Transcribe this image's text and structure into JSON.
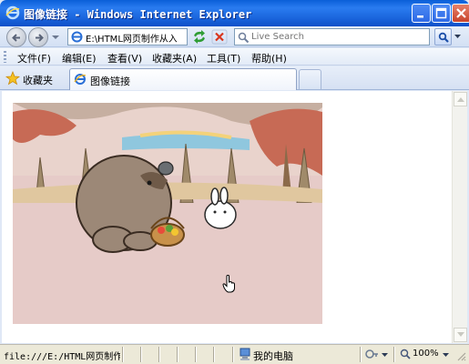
{
  "window": {
    "title": "图像链接 - Windows Internet Explorer"
  },
  "address_bar": {
    "url": "E:\\HTML网页制作从入",
    "search_placeholder": "Live Search"
  },
  "menu": {
    "items": [
      "文件(F)",
      "编辑(E)",
      "查看(V)",
      "收藏夹(A)",
      "工具(T)",
      "帮助(H)"
    ]
  },
  "favorites": {
    "label": "收藏夹"
  },
  "tabs": [
    {
      "label": "图像链接",
      "active": true
    }
  ],
  "content": {
    "image_alt": "cartoon bear and rabbit with a fruit basket"
  },
  "status_bar": {
    "url_text": "file:///E:/HTML网页制作从",
    "zone": "我的电脑",
    "zoom": "100%"
  },
  "colors": {
    "titlebar": "#1a64dc",
    "image_background": "#e6cbc8",
    "chrome": "#dfe8f6"
  },
  "icons": [
    "ie-logo-icon",
    "minimize-icon",
    "maximize-icon",
    "close-icon",
    "back-icon",
    "forward-icon",
    "refresh-icon",
    "stop-icon",
    "search-icon",
    "star-icon",
    "computer-icon",
    "protected-mode-icon",
    "zoom-icon",
    "hand-cursor-icon"
  ]
}
